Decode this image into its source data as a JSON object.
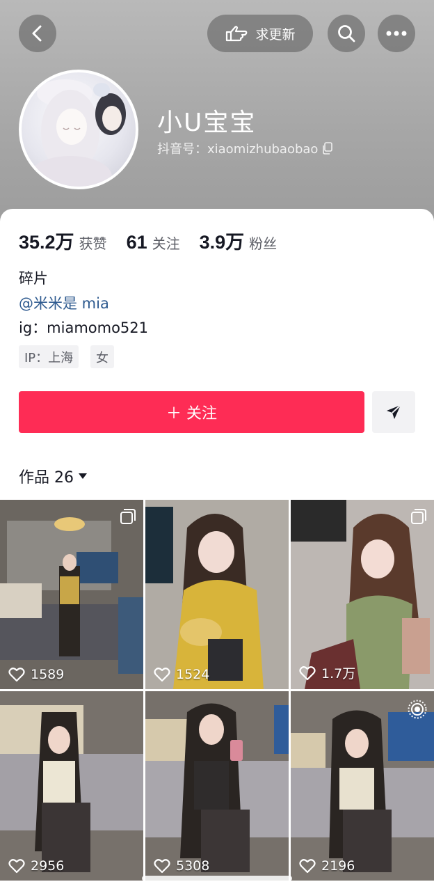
{
  "header": {
    "update_button_label": "求更新",
    "back_icon": "chevron-left-icon",
    "search_icon": "search-icon",
    "more_icon": "more-dots-icon"
  },
  "profile": {
    "name": "小U宝宝",
    "handle": "抖音号：xiaomizhubaobao"
  },
  "stats": [
    {
      "value": "35.2万",
      "label": "获赞"
    },
    {
      "value": "61",
      "label": "关注"
    },
    {
      "value": "3.9万",
      "label": "粉丝"
    }
  ],
  "bio": {
    "line1": "碎片",
    "mention": "@米米是 mia",
    "line3": "ig：miamomo521"
  },
  "tags": [
    "IP：上海",
    "女"
  ],
  "actions": {
    "follow_label": "＋ 关注",
    "share_icon": "send-icon"
  },
  "works": {
    "label": "作品 26",
    "videos": [
      {
        "likes": "1589",
        "badge": "multi-image"
      },
      {
        "likes": "1524",
        "badge": ""
      },
      {
        "likes": "1.7万",
        "badge": "multi-image"
      },
      {
        "likes": "2956",
        "badge": ""
      },
      {
        "likes": "5308",
        "badge": ""
      },
      {
        "likes": "2196",
        "badge": "live"
      }
    ]
  },
  "colors": {
    "accent": "#fe2c55",
    "text": "#161823",
    "secondary_text": "#5c5e66",
    "tag_bg": "#f2f2f4"
  }
}
